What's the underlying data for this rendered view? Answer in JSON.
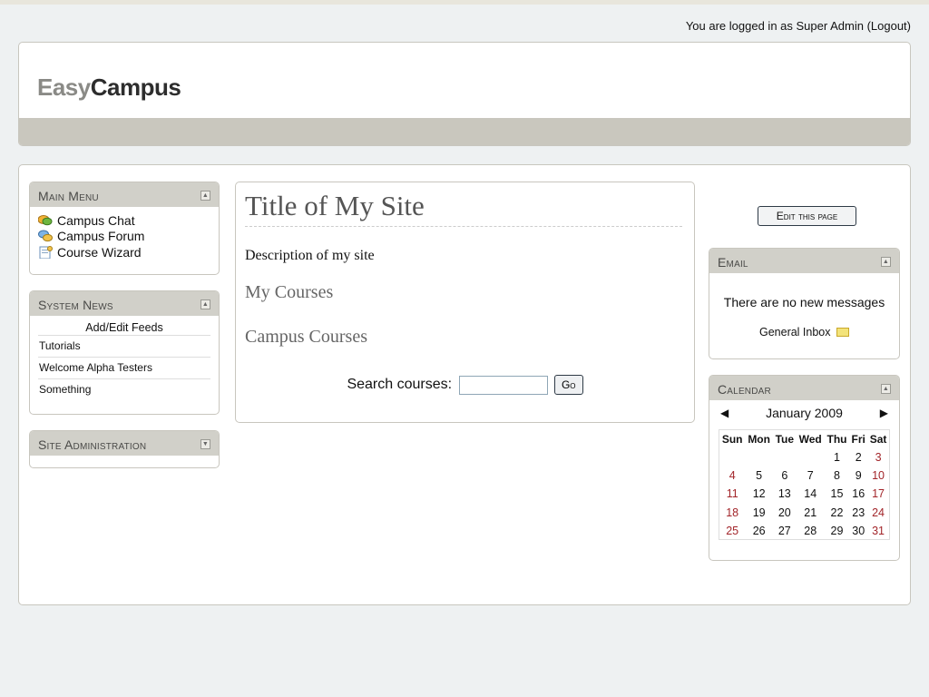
{
  "login": {
    "prefix": "You are logged in as",
    "user": "Super Admin",
    "logout": "(Logout)"
  },
  "brand": {
    "easy": "Easy",
    "campus": "Campus"
  },
  "main_menu": {
    "title": "Main Menu",
    "items": [
      {
        "label": "Campus Chat",
        "icon": "chat-icon"
      },
      {
        "label": "Campus Forum",
        "icon": "forum-icon"
      },
      {
        "label": "Course Wizard",
        "icon": "wizard-icon"
      }
    ]
  },
  "system_news": {
    "title": "System News",
    "feeds_link": "Add/Edit Feeds",
    "items": [
      "Tutorials",
      "Welcome Alpha Testers",
      "Something"
    ]
  },
  "site_admin": {
    "title": "Site Administration"
  },
  "content": {
    "site_title": "Title of My Site",
    "description": "Description of my site",
    "my_courses": "My Courses",
    "campus_courses": "Campus Courses",
    "search_label": "Search courses:",
    "search_value": "",
    "go_label": "Go"
  },
  "edit_page_label": "Edit this page",
  "email": {
    "title": "Email",
    "message": "There are no new messages",
    "inbox": "General Inbox"
  },
  "calendar": {
    "title": "Calendar",
    "prev": "◀",
    "next": "▶",
    "month": "January 2009",
    "weekdays": [
      "Sun",
      "Mon",
      "Tue",
      "Wed",
      "Thu",
      "Fri",
      "Sat"
    ],
    "weeks": [
      [
        "",
        "",
        "",
        "",
        "1",
        "2",
        "3"
      ],
      [
        "4",
        "5",
        "6",
        "7",
        "8",
        "9",
        "10"
      ],
      [
        "11",
        "12",
        "13",
        "14",
        "15",
        "16",
        "17"
      ],
      [
        "18",
        "19",
        "20",
        "21",
        "22",
        "23",
        "24"
      ],
      [
        "25",
        "26",
        "27",
        "28",
        "29",
        "30",
        "31"
      ]
    ]
  },
  "colors": {
    "block_header": "#d1d0c9",
    "weekend": "#a2252a",
    "page_bg": "#eef1f2"
  }
}
